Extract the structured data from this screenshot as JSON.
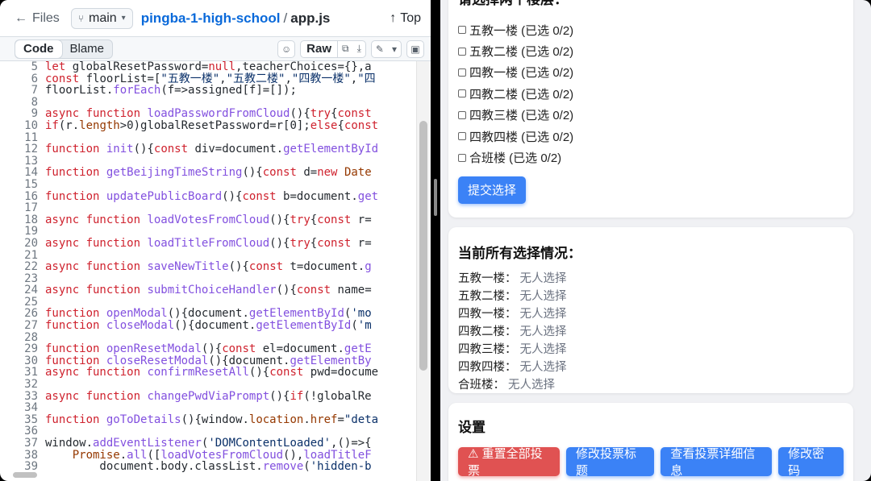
{
  "github": {
    "files_label": "Files",
    "branch": "main",
    "repo": "pingba-1-high-school",
    "path_sep": "/",
    "file": "app.js",
    "top_label": "Top",
    "tabs": [
      "Code",
      "Blame"
    ],
    "raw_label": "Raw"
  },
  "code_lines": [
    {
      "n": "5",
      "html": "<span class=\"kw\">let</span> globalResetPassword=<span class=\"kw\">null</span>,teacherChoices={},a"
    },
    {
      "n": "6",
      "html": "<span class=\"kw\">const</span> floorList=[<span class=\"str\">\"五教一楼\"</span>,<span class=\"str\">\"五教二楼\"</span>,<span class=\"str\">\"四教一楼\"</span>,<span class=\"str\">\"四</span>"
    },
    {
      "n": "7",
      "html": "floorList.<span class=\"fn\">forEach</span>(f=>assigned[f]=[]);"
    },
    {
      "n": "8",
      "html": ""
    },
    {
      "n": "9",
      "html": "<span class=\"kw\">async function</span> <span class=\"fn\">loadPasswordFromCloud</span>(){<span class=\"kw\">try</span>{<span class=\"kw\">const</span>"
    },
    {
      "n": "10",
      "html": "<span class=\"kw\">if</span>(r.<span class=\"var\">length</span>>0)globalResetPassword=r[0];<span class=\"kw\">else</span>{<span class=\"kw\">const</span>"
    },
    {
      "n": "11",
      "html": ""
    },
    {
      "n": "12",
      "html": "<span class=\"kw\">function</span> <span class=\"fn\">init</span>(){<span class=\"kw\">const</span> div=document.<span class=\"fn\">getElementById</span>"
    },
    {
      "n": "13",
      "html": ""
    },
    {
      "n": "14",
      "html": "<span class=\"kw\">function</span> <span class=\"fn\">getBeijingTimeString</span>(){<span class=\"kw\">const</span> d=<span class=\"kw\">new</span> <span class=\"var\">Date</span>"
    },
    {
      "n": "15",
      "html": ""
    },
    {
      "n": "16",
      "html": "<span class=\"kw\">function</span> <span class=\"fn\">updatePublicBoard</span>(){<span class=\"kw\">const</span> b=document.<span class=\"fn\">get</span>"
    },
    {
      "n": "17",
      "html": ""
    },
    {
      "n": "18",
      "html": "<span class=\"kw\">async function</span> <span class=\"fn\">loadVotesFromCloud</span>(){<span class=\"kw\">try</span>{<span class=\"kw\">const</span> r="
    },
    {
      "n": "19",
      "html": ""
    },
    {
      "n": "20",
      "html": "<span class=\"kw\">async function</span> <span class=\"fn\">loadTitleFromCloud</span>(){<span class=\"kw\">try</span>{<span class=\"kw\">const</span> r="
    },
    {
      "n": "21",
      "html": ""
    },
    {
      "n": "22",
      "html": "<span class=\"kw\">async function</span> <span class=\"fn\">saveNewTitle</span>(){<span class=\"kw\">const</span> t=document.<span class=\"fn\">g</span>"
    },
    {
      "n": "23",
      "html": ""
    },
    {
      "n": "24",
      "html": "<span class=\"kw\">async function</span> <span class=\"fn\">submitChoiceHandler</span>(){<span class=\"kw\">const</span> name="
    },
    {
      "n": "25",
      "html": ""
    },
    {
      "n": "26",
      "html": "<span class=\"kw\">function</span> <span class=\"fn\">openModal</span>(){document.<span class=\"fn\">getElementById</span>(<span class=\"str\">'mo</span>"
    },
    {
      "n": "27",
      "html": "<span class=\"kw\">function</span> <span class=\"fn\">closeModal</span>(){document.<span class=\"fn\">getElementById</span>(<span class=\"str\">'m</span>"
    },
    {
      "n": "28",
      "html": ""
    },
    {
      "n": "29",
      "html": "<span class=\"kw\">function</span> <span class=\"fn\">openResetModal</span>(){<span class=\"kw\">const</span> el=document.<span class=\"fn\">getE</span>"
    },
    {
      "n": "30",
      "html": "<span class=\"kw\">function</span> <span class=\"fn\">closeResetModal</span>(){document.<span class=\"fn\">getElementBy</span>"
    },
    {
      "n": "31",
      "html": "<span class=\"kw\">async function</span> <span class=\"fn\">confirmResetAll</span>(){<span class=\"kw\">const</span> pwd=docume"
    },
    {
      "n": "32",
      "html": ""
    },
    {
      "n": "33",
      "html": "<span class=\"kw\">async function</span> <span class=\"fn\">changePwdViaPrompt</span>(){<span class=\"kw\">if</span>(!globalRe"
    },
    {
      "n": "34",
      "html": ""
    },
    {
      "n": "35",
      "html": "<span class=\"kw\">function</span> <span class=\"fn\">goToDetails</span>(){window.<span class=\"var\">location</span>.<span class=\"var\">href</span>=<span class=\"str\">\"deta</span>"
    },
    {
      "n": "36",
      "html": ""
    },
    {
      "n": "37",
      "html": "window.<span class=\"fn\">addEventListener</span>(<span class=\"str\">'DOMContentLoaded'</span>,()=>{"
    },
    {
      "n": "38",
      "html": "    <span class=\"var\">Promise</span>.<span class=\"fn\">all</span>([<span class=\"fn\">loadVotesFromCloud</span>(),<span class=\"fn\">loadTitleF</span>"
    },
    {
      "n": "39",
      "html": "        document.body.classList.<span class=\"fn\">remove</span>(<span class=\"str\">'hidden-b</span>"
    }
  ],
  "app": {
    "clipped_title": "请选择两个楼层：",
    "options": [
      "五教一楼 (已选 0/2)",
      "五教二楼 (已选 0/2)",
      "四教一楼 (已选 0/2)",
      "四教二楼 (已选 0/2)",
      "四教三楼 (已选 0/2)",
      "四教四楼 (已选 0/2)",
      "合班楼 (已选 0/2)"
    ],
    "submit_label": "提交选择",
    "status_title": "当前所有选择情况：",
    "status": [
      {
        "floor": "五教一楼：",
        "value": "无人选择"
      },
      {
        "floor": "五教二楼：",
        "value": "无人选择"
      },
      {
        "floor": "四教一楼：",
        "value": "无人选择"
      },
      {
        "floor": "四教二楼：",
        "value": "无人选择"
      },
      {
        "floor": "四教三楼：",
        "value": "无人选择"
      },
      {
        "floor": "四教四楼：",
        "value": "无人选择"
      },
      {
        "floor": "合班楼：",
        "value": "无人选择"
      }
    ],
    "settings_title": "设置",
    "buttons": {
      "reset_all": "⚠ 重置全部投票",
      "edit_title": "修改投票标题",
      "view_details": "查看投票详细信息",
      "change_password": "修改密码"
    },
    "colors": {
      "primary": "#3b82f6",
      "danger": "#e05252",
      "muted": "#6b7280"
    }
  }
}
